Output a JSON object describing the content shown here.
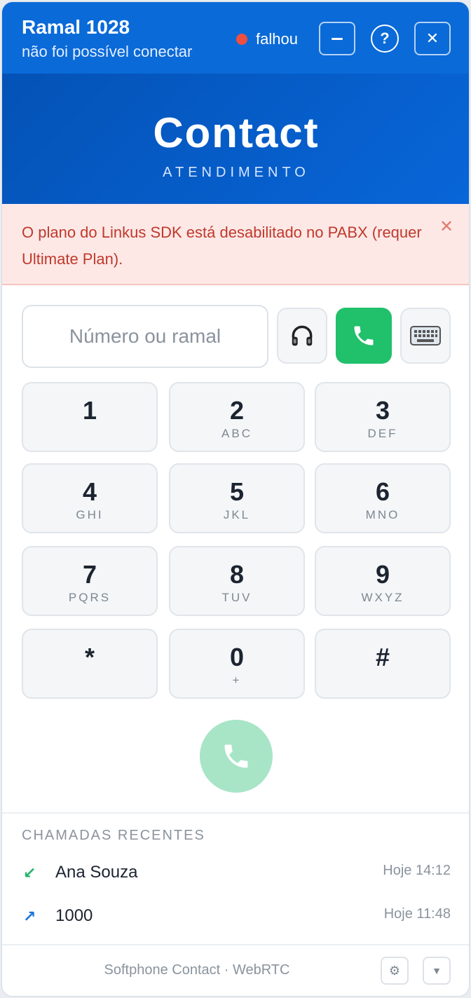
{
  "header": {
    "title": "Ramal 1028",
    "subtitle": "não foi possível conectar",
    "status": "falhou",
    "status_color": "#ef4f3f",
    "minimize_icon": "minus-icon",
    "help_label": "?",
    "close_label": "✕"
  },
  "brand": {
    "name": "Contact",
    "tagline": "ATENDIMENTO"
  },
  "alert": {
    "message": "O plano do Linkus SDK está desabilitado no PABX (requer Ultimate Plan).",
    "close_label": "✕"
  },
  "dialer": {
    "placeholder": "Número ou ramal",
    "headset_icon": "headset-icon",
    "call_icon": "phone-icon",
    "keyboard_icon": "keyboard-icon",
    "accent": "#21c06b",
    "keys": [
      {
        "digit": "1",
        "letters": ""
      },
      {
        "digit": "2",
        "letters": "ABC"
      },
      {
        "digit": "3",
        "letters": "DEF"
      },
      {
        "digit": "4",
        "letters": "GHI"
      },
      {
        "digit": "5",
        "letters": "JKL"
      },
      {
        "digit": "6",
        "letters": "MNO"
      },
      {
        "digit": "7",
        "letters": "PQRS"
      },
      {
        "digit": "8",
        "letters": "TUV"
      },
      {
        "digit": "9",
        "letters": "WXYZ"
      },
      {
        "digit": "*",
        "letters": ""
      },
      {
        "digit": "0",
        "letters": "+"
      },
      {
        "digit": "#",
        "letters": ""
      }
    ]
  },
  "recent": {
    "title": "CHAMADAS RECENTES",
    "calls": [
      {
        "direction": "incoming",
        "icon": "↙",
        "name": "Ana Souza",
        "time": "Hoje 14:12"
      },
      {
        "direction": "outgoing",
        "icon": "↗",
        "name": "1000",
        "time": "Hoje 11:48"
      }
    ]
  },
  "footer": {
    "text": "Softphone Contact · WebRTC",
    "settings_icon": "⚙",
    "collapse_icon": "▼"
  }
}
